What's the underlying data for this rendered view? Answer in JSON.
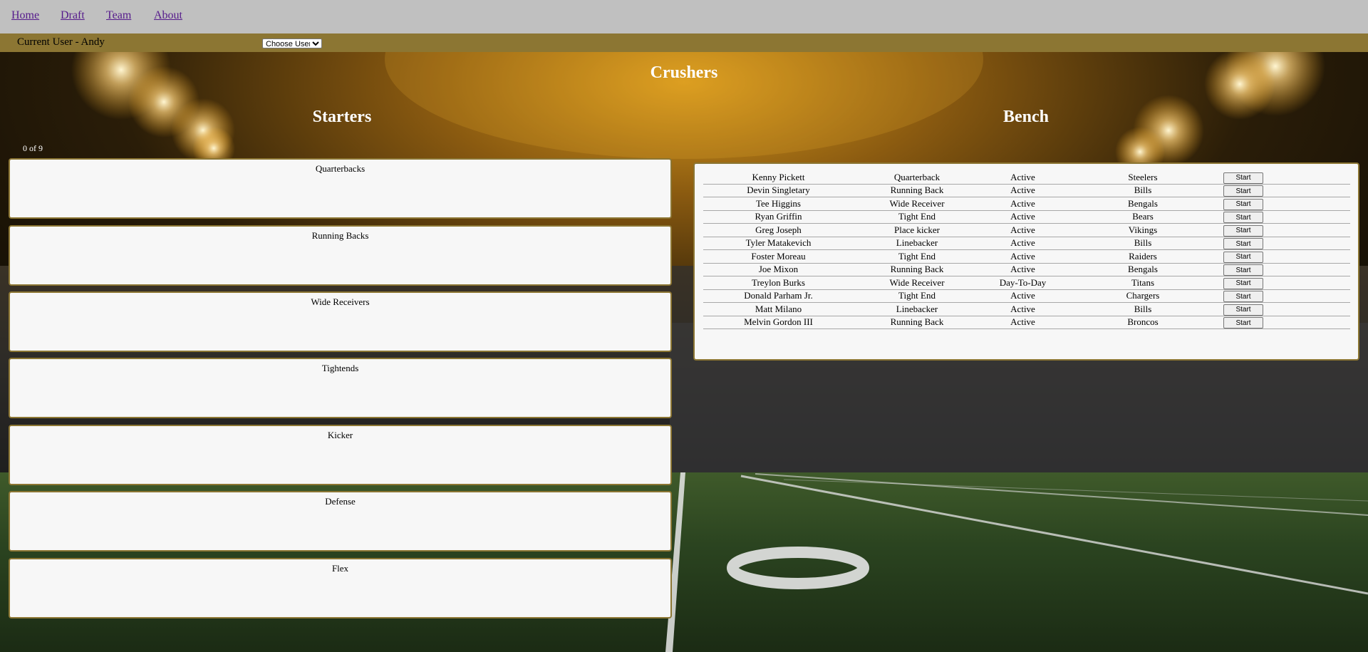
{
  "nav": {
    "links": [
      "Home",
      "Draft",
      "Team",
      "About"
    ]
  },
  "user_bar": {
    "current_user": "Current User - Andy",
    "select_value": "Choose User"
  },
  "team": {
    "name": "Crushers"
  },
  "starters": {
    "title": "Starters",
    "count": "0 of 9",
    "slots": [
      "Quarterbacks",
      "Running Backs",
      "Wide Receivers",
      "Tightends",
      "Kicker",
      "Defense",
      "Flex"
    ]
  },
  "bench": {
    "title": "Bench",
    "button_label": "Start",
    "players": [
      {
        "name": "Kenny Pickett",
        "position": "Quarterback",
        "status": "Active",
        "team": "Steelers"
      },
      {
        "name": "Devin Singletary",
        "position": "Running Back",
        "status": "Active",
        "team": "Bills"
      },
      {
        "name": "Tee Higgins",
        "position": "Wide Receiver",
        "status": "Active",
        "team": "Bengals"
      },
      {
        "name": "Ryan Griffin",
        "position": "Tight End",
        "status": "Active",
        "team": "Bears"
      },
      {
        "name": "Greg Joseph",
        "position": "Place kicker",
        "status": "Active",
        "team": "Vikings"
      },
      {
        "name": "Tyler Matakevich",
        "position": "Linebacker",
        "status": "Active",
        "team": "Bills"
      },
      {
        "name": "Foster Moreau",
        "position": "Tight End",
        "status": "Active",
        "team": "Raiders"
      },
      {
        "name": "Joe Mixon",
        "position": "Running Back",
        "status": "Active",
        "team": "Bengals"
      },
      {
        "name": "Treylon Burks",
        "position": "Wide Receiver",
        "status": "Day-To-Day",
        "team": "Titans"
      },
      {
        "name": "Donald Parham Jr.",
        "position": "Tight End",
        "status": "Active",
        "team": "Chargers"
      },
      {
        "name": "Matt Milano",
        "position": "Linebacker",
        "status": "Active",
        "team": "Bills"
      },
      {
        "name": "Melvin Gordon III",
        "position": "Running Back",
        "status": "Active",
        "team": "Broncos"
      }
    ]
  },
  "colors": {
    "nav_bg": "#c0c0c0",
    "user_bar_bg": "#8c7633",
    "panel_border": "#8c7633",
    "panel_bg": "#f7f7f7",
    "link": "#551a8b"
  },
  "background": {
    "field_marking": "0"
  }
}
